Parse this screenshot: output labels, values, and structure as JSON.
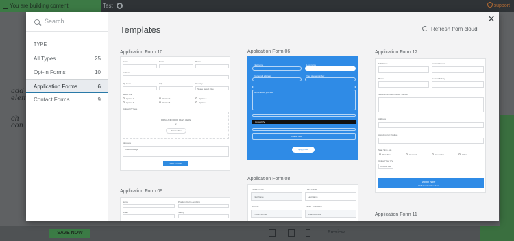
{
  "background": {
    "editing_label": "You are building content",
    "tab_label": "Test",
    "support_label": "support",
    "save_label": "SAVE NOW",
    "preview_label": "Preview",
    "scribble_1": "add",
    "scribble_2": "eleme",
    "scribble_3": "ch",
    "scribble_4": "con"
  },
  "sidebar": {
    "search_placeholder": "Search",
    "type_heading": "TYPE",
    "items": [
      {
        "label": "All Types",
        "count": "25"
      },
      {
        "label": "Opt-in Forms",
        "count": "10"
      },
      {
        "label": "Application Forms",
        "count": "6"
      },
      {
        "label": "Contact Forms",
        "count": "9"
      }
    ]
  },
  "main": {
    "title": "Templates",
    "refresh_label": "Refresh from cloud",
    "cards": [
      {
        "name": "Application Form 10"
      },
      {
        "name": "Application Form 06"
      },
      {
        "name": "Application Form 12"
      },
      {
        "name": "Application Form 09"
      },
      {
        "name": "Application Form 08"
      },
      {
        "name": "Application Form 11"
      }
    ]
  },
  "colors": {
    "accent": "#2a7aa8",
    "form_blue": "#2f8be6",
    "editing_green": "#3c7a45"
  },
  "icons": {
    "search": "search-icon",
    "refresh": "refresh-icon",
    "close": "close-icon"
  },
  "previews": {
    "f10": {
      "name": "Name",
      "email": "Email",
      "phone": "Phone",
      "address": "Address",
      "zip": "Zip Code",
      "city": "City",
      "country": "Country",
      "country_value": "Please Select One",
      "select_one": "Select one",
      "options": [
        "Option 1",
        "Option 2",
        "Option 3",
        "Option 4",
        "Option 5",
        "Option 6"
      ],
      "upload": "Upload CV here",
      "drop": "DRAG AND DROP FILES HERE",
      "or": "or",
      "browse": "Browse Files",
      "message": "Message",
      "message_ph": "Write message",
      "apply": "APPLY NOW"
    },
    "f06": {
      "first": "First name",
      "last": "Last name",
      "email": "Your email address",
      "phone": "Your phone number",
      "tell": "Tell us about yourself",
      "upload": "Upload CV",
      "choose": "Choose files",
      "apply": "Apply Now"
    },
    "f12": {
      "full_name": "Full Name",
      "email": "Email Address",
      "phone": "Phone",
      "current": "Current Salary",
      "essay": "Some Information About Yourself",
      "address": "Address",
      "applying": "Applying For Position",
      "start": "Start Time Job",
      "options": [
        "Part Time",
        "Contract",
        "Internship",
        "Other"
      ],
      "upload": "Upload Your CV",
      "choose": "Choose File",
      "apply": "Apply Now",
      "apply_sub": "We'll Contact You Soon"
    },
    "f08": {
      "first": "FIRST NAME",
      "last": "LAST NAME",
      "first_ph": "First Name",
      "last_ph": "Last Name",
      "phone": "PHONE",
      "email": "EMAIL ADDRESS",
      "phone_ph": "Phone Number",
      "email_ph": "Email Address"
    },
    "f09": {
      "name": "Name",
      "position": "Position You're Applying",
      "email": "Email",
      "salary": "Salary"
    }
  }
}
